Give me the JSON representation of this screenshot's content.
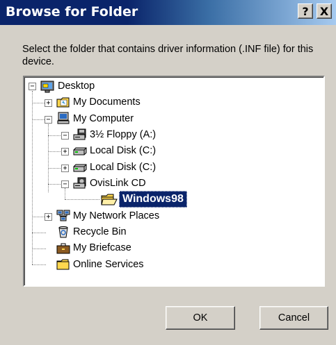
{
  "window": {
    "title": "Browse for Folder",
    "help_glyph": "?",
    "close_glyph": "X"
  },
  "description": "Select the folder that contains driver information (.INF file) for this device.",
  "tree": {
    "nodes": [
      {
        "label": "Desktop",
        "icon": "desktop-icon",
        "expander": "−"
      },
      {
        "label": "My Documents",
        "icon": "my-documents-icon",
        "expander": "+"
      },
      {
        "label": "My Computer",
        "icon": "my-computer-icon",
        "expander": "−"
      },
      {
        "label": "3½ Floppy (A:)",
        "icon": "floppy-drive-icon",
        "expander": "−"
      },
      {
        "label": "Local Disk (C:)",
        "icon": "hard-disk-icon",
        "expander": "+"
      },
      {
        "label": "Local Disk (C:)",
        "icon": "hard-disk-icon",
        "expander": "+"
      },
      {
        "label": "OvisLink CD",
        "icon": "cd-drive-icon",
        "expander": "−"
      },
      {
        "label": "Windows98",
        "icon": "open-folder-icon",
        "selected": true
      },
      {
        "label": "My Network Places",
        "icon": "network-places-icon",
        "expander": "+"
      },
      {
        "label": "Recycle Bin",
        "icon": "recycle-bin-icon"
      },
      {
        "label": "My Briefcase",
        "icon": "briefcase-icon"
      },
      {
        "label": "Online Services",
        "icon": "folder-icon"
      }
    ]
  },
  "buttons": {
    "ok": "OK",
    "cancel": "Cancel"
  },
  "colors": {
    "title_bar": "#0a246a",
    "selection": "#0a246a",
    "dialog_face": "#d4d0c8"
  }
}
